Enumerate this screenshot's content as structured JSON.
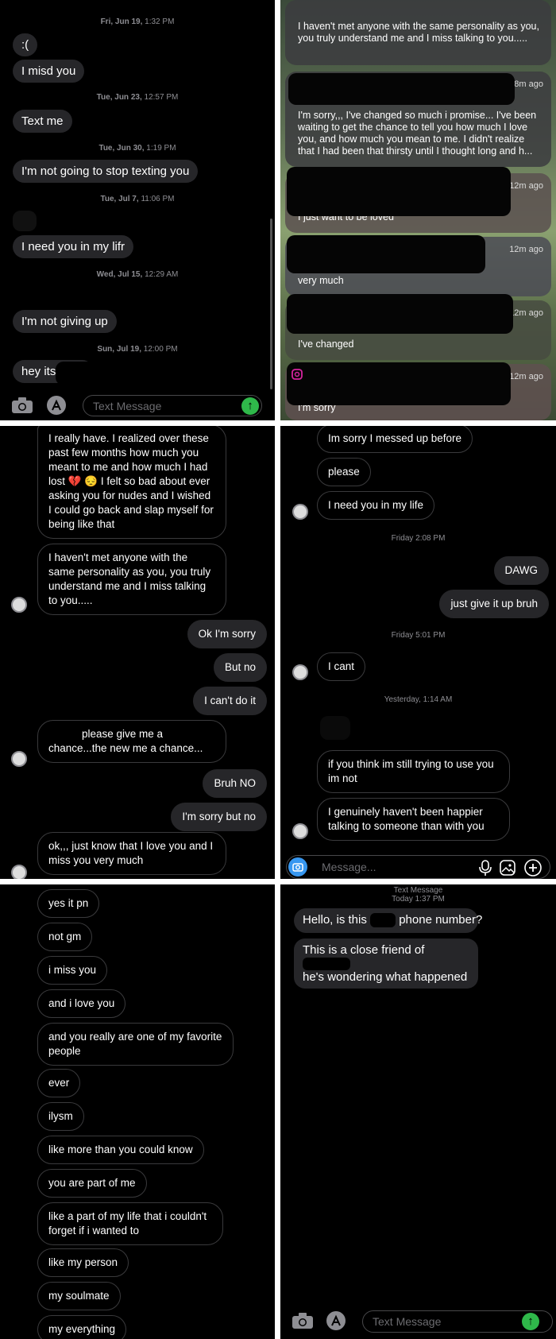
{
  "panel1": {
    "timestamps": [
      {
        "day": "Fri, Jun 19,",
        "time": "1:32 PM"
      },
      {
        "day": "Tue, Jun 23,",
        "time": "12:57 PM"
      },
      {
        "day": "Tue, Jun 30,",
        "time": "1:19 PM"
      },
      {
        "day": "Tue, Jul 7,",
        "time": "11:06 PM"
      },
      {
        "day": "Wed, Jul 15,",
        "time": "12:29 AM"
      },
      {
        "day": "Sun, Jul 19,",
        "time": "12:00 PM"
      }
    ],
    "messages": [
      ":(",
      "I misd you",
      "Text me",
      "I'm not going to stop texting you",
      "I need you in my lifr",
      "I'm not giving up",
      "hey its"
    ],
    "input_placeholder": "Text Message"
  },
  "panel2": {
    "notifications": [
      {
        "ago": "",
        "text": "I haven't met anyone with the same personality as you, you truly understand me and I miss talking to you....."
      },
      {
        "ago": "8m ago",
        "text": "I'm sorry,,, I've changed so much i promise... I've been waiting to get the chance to tell you how much I love you, and how much you mean to me. I didn't realize that I had been that thirsty until I thought long and h..."
      },
      {
        "ago": "12m ago",
        "text": "I just want to be loved"
      },
      {
        "ago": "12m ago",
        "text": "very much"
      },
      {
        "ago": "12m ago",
        "text": "I've changed"
      },
      {
        "ago": "12m ago",
        "text": "I'm sorry"
      }
    ]
  },
  "panel3": {
    "incoming_1": "I really have. I realized over these past few months how much you meant to me and how much I had lost 💔 😔 I felt so bad about ever asking you for nudes and I wished I could go back and slap myself for being like that",
    "incoming_2": "I haven't met anyone with the same personality as you, you truly understand me and I miss talking to you.....",
    "outgoing_1": "Ok I'm sorry",
    "outgoing_2": "But no",
    "outgoing_3": "I can't do it",
    "incoming_3": "please give me a chance...the new me a chance...",
    "outgoing_4": "Bruh NO",
    "outgoing_5": "I'm sorry but no",
    "incoming_4": "ok,,, just know that I love you and I miss you  very much"
  },
  "panel4": {
    "incoming_a": [
      "Im sorry I messed up before",
      "please",
      "I need you in my life"
    ],
    "ts1": "Friday 2:08 PM",
    "outgoing": [
      "DAWG",
      "just give it up bruh"
    ],
    "ts2": "Friday 5:01 PM",
    "incoming_b": "I cant",
    "ts3": "Yesterday, 1:14 AM",
    "incoming_c": [
      "if you think im still trying to use you im not",
      "I genuinely haven't been happier talking to someone than with you"
    ],
    "input_placeholder": "Message..."
  },
  "panel5": {
    "messages": [
      "yes it pn",
      "not gm",
      "i miss you",
      "and i love you",
      "and you really are one of my favorite people",
      "ever",
      "ilysm",
      "like more than you could know",
      "you are part of me",
      "like a part of my life that i couldn't forget if i wanted to",
      "like my person",
      "my soulmate",
      "my everything"
    ]
  },
  "panel6": {
    "header_line1": "Text Message",
    "header_line2": "Today 1:37 PM",
    "msg1_a": "Hello, is this",
    "msg1_b": "phone number?",
    "msg2_a": "This is a close friend of",
    "msg2_b": "he's wondering what happened",
    "input_placeholder": "Text Message"
  },
  "colors": {
    "bubble_gray": "#262629",
    "send_green": "#2fb84a",
    "timestamp": "#8e8e93"
  }
}
